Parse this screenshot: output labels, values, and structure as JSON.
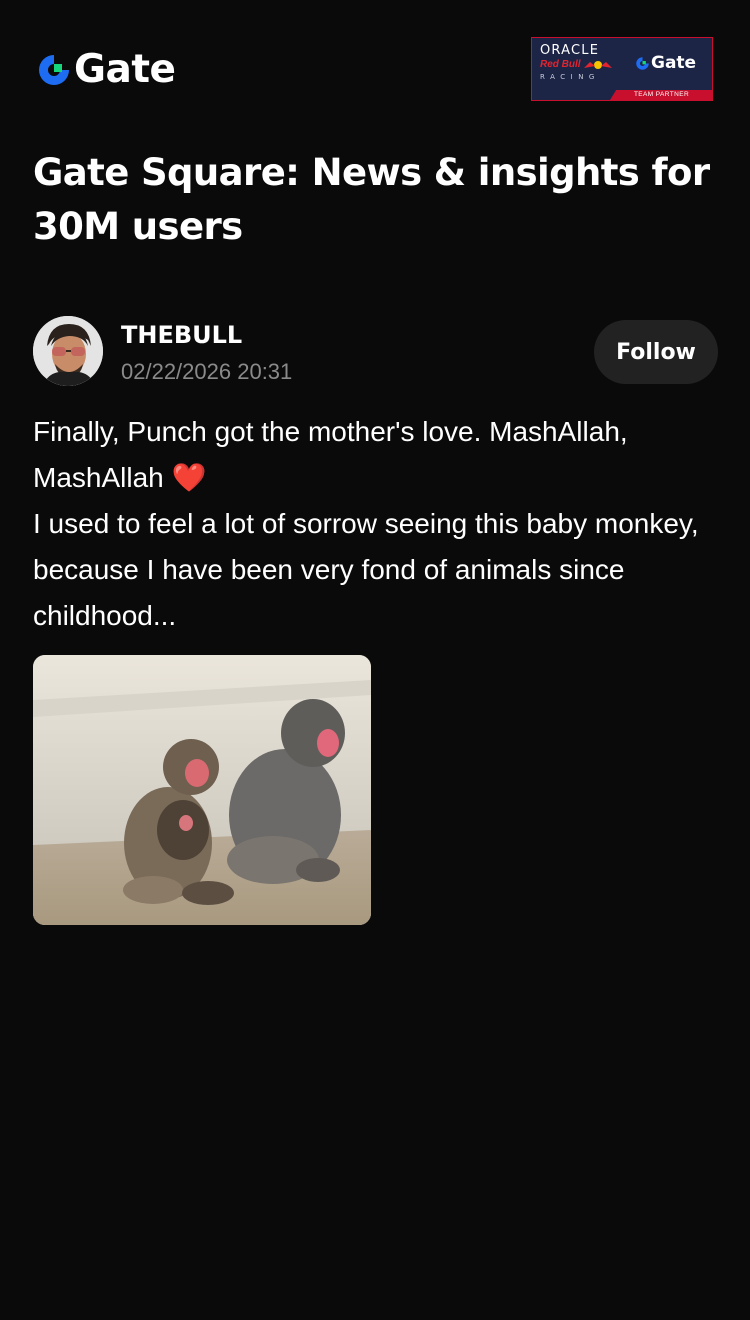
{
  "brand": {
    "name": "Gate",
    "accent": "#1d6cf2",
    "mark_color": "#15d67a"
  },
  "partner_badge": {
    "line1": "ORACLE",
    "line2": "Red Bull",
    "line3": "RACING",
    "brand": "Gate",
    "strip": "TEAM PARTNER",
    "background": "#1d2547",
    "accent": "#c8102e"
  },
  "page_title": "Gate Square: News & insights for 30M users",
  "post": {
    "author": {
      "name": "THEBULL",
      "timestamp": "02/22/2026 20:31",
      "avatar_icon": "avatar"
    },
    "follow_label": "Follow",
    "lines": {
      "l1": "Finally, Punch got the mother's love. MashAllah, MashAllah",
      "heart": "❤️",
      "l2": "I used to feel a lot of sorrow seeing this baby monkey, because I have been very fond of animals since childhood..."
    },
    "image_icon": "monkeys-photo"
  }
}
